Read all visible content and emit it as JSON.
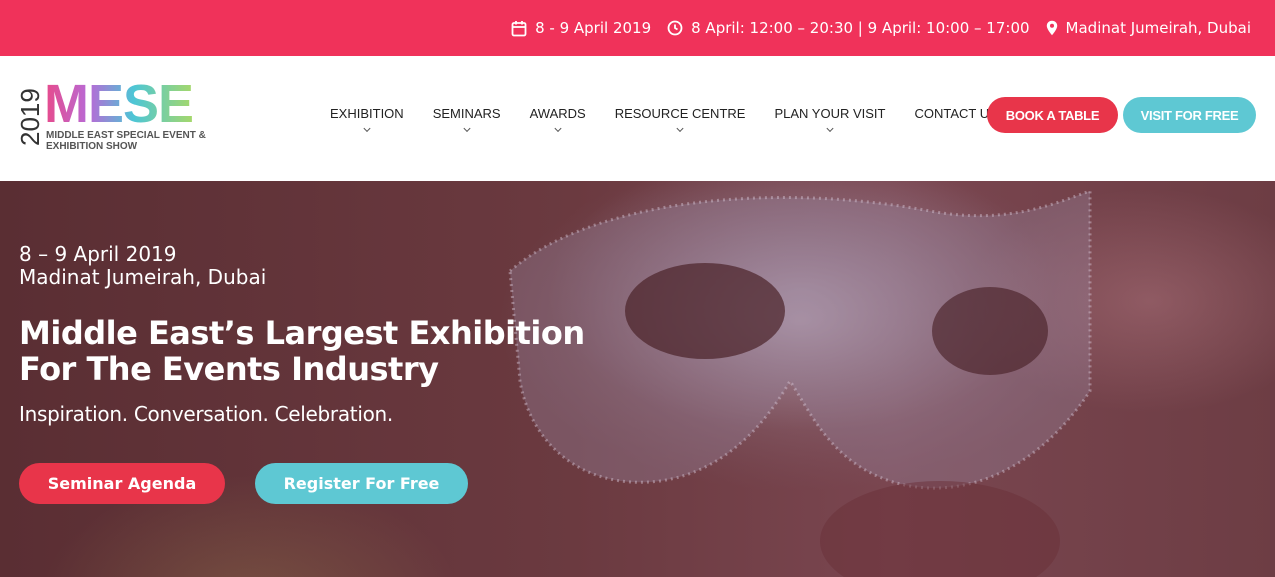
{
  "topbar": {
    "dates": "8 - 9 April 2019",
    "hours": "8 April: 12:00 – 20:30 | 9 April: 10:00 – 17:00",
    "venue": "Madinat Jumeirah, Dubai",
    "icons": [
      "calendar-icon",
      "clock-icon",
      "location-pin-icon"
    ],
    "background": "#f0325a"
  },
  "logo": {
    "year": "2019",
    "name": "MESE",
    "tagline": "MIDDLE EAST SPECIAL EVENT & EXHIBITION SHOW"
  },
  "nav": {
    "items": [
      {
        "label": "EXHIBITION",
        "has_dropdown": true
      },
      {
        "label": "SEMINARS",
        "has_dropdown": true
      },
      {
        "label": "AWARDS",
        "has_dropdown": true
      },
      {
        "label": "RESOURCE CENTRE",
        "has_dropdown": true
      },
      {
        "label": "PLAN YOUR VISIT",
        "has_dropdown": true
      },
      {
        "label": "CONTACT US",
        "has_dropdown": false
      }
    ],
    "book_label": "BOOK A TABLE",
    "visit_label": "VISIT FOR FREE"
  },
  "hero": {
    "date": "8 – 9 April 2019",
    "venue": "Madinat Jumeirah, Dubai",
    "title": "Middle East’s Largest Exhibition For The Events Industry",
    "subtitle": "Inspiration. Conversation. Celebration.",
    "agenda_label": "Seminar Agenda",
    "register_label": "Register For Free"
  },
  "colors": {
    "accent_red": "#e8354a",
    "accent_teal": "#5ec8d3"
  }
}
